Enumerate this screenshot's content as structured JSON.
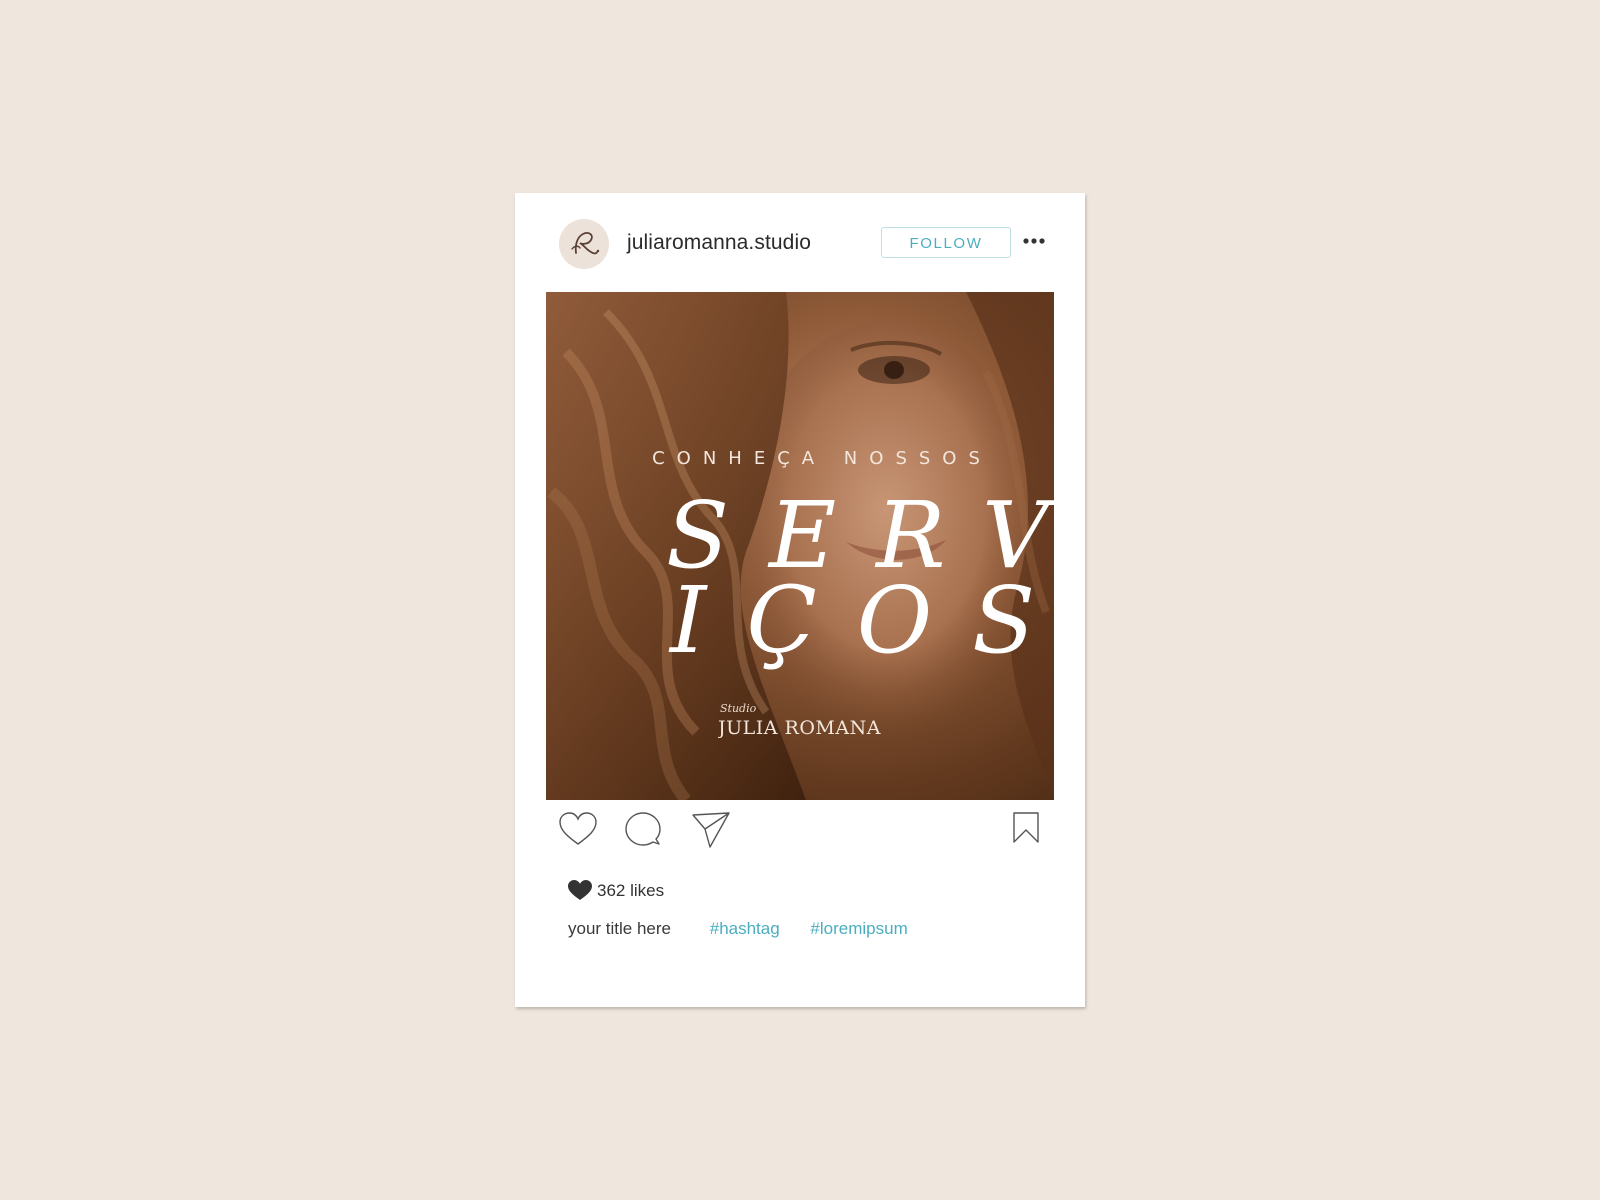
{
  "post": {
    "username": "juliaromanna.studio",
    "follow_label": "FOLLOW",
    "image": {
      "subtitle": "CONHEÇA NOSSOS",
      "title_line1": "SERV",
      "title_line2": "IÇOS",
      "brand_small": "Studio",
      "brand_name": "JULIA ROMANA"
    },
    "likes": "362 likes",
    "caption": {
      "title": "your title here",
      "hashtags": [
        "#hashtag",
        "#loremipsum"
      ]
    }
  },
  "icons": {
    "avatar": "script-r-logo-icon",
    "more": "more-dots-icon",
    "like": "heart-outline-icon",
    "comment": "comment-bubble-icon",
    "share": "paper-plane-icon",
    "save": "bookmark-icon",
    "likes_indicator": "heart-filled-icon"
  },
  "colors": {
    "background": "#efe6de",
    "card": "#ffffff",
    "accent": "#4aaebf",
    "follow_border": "#bde0e6",
    "text": "#2b2b2b"
  }
}
